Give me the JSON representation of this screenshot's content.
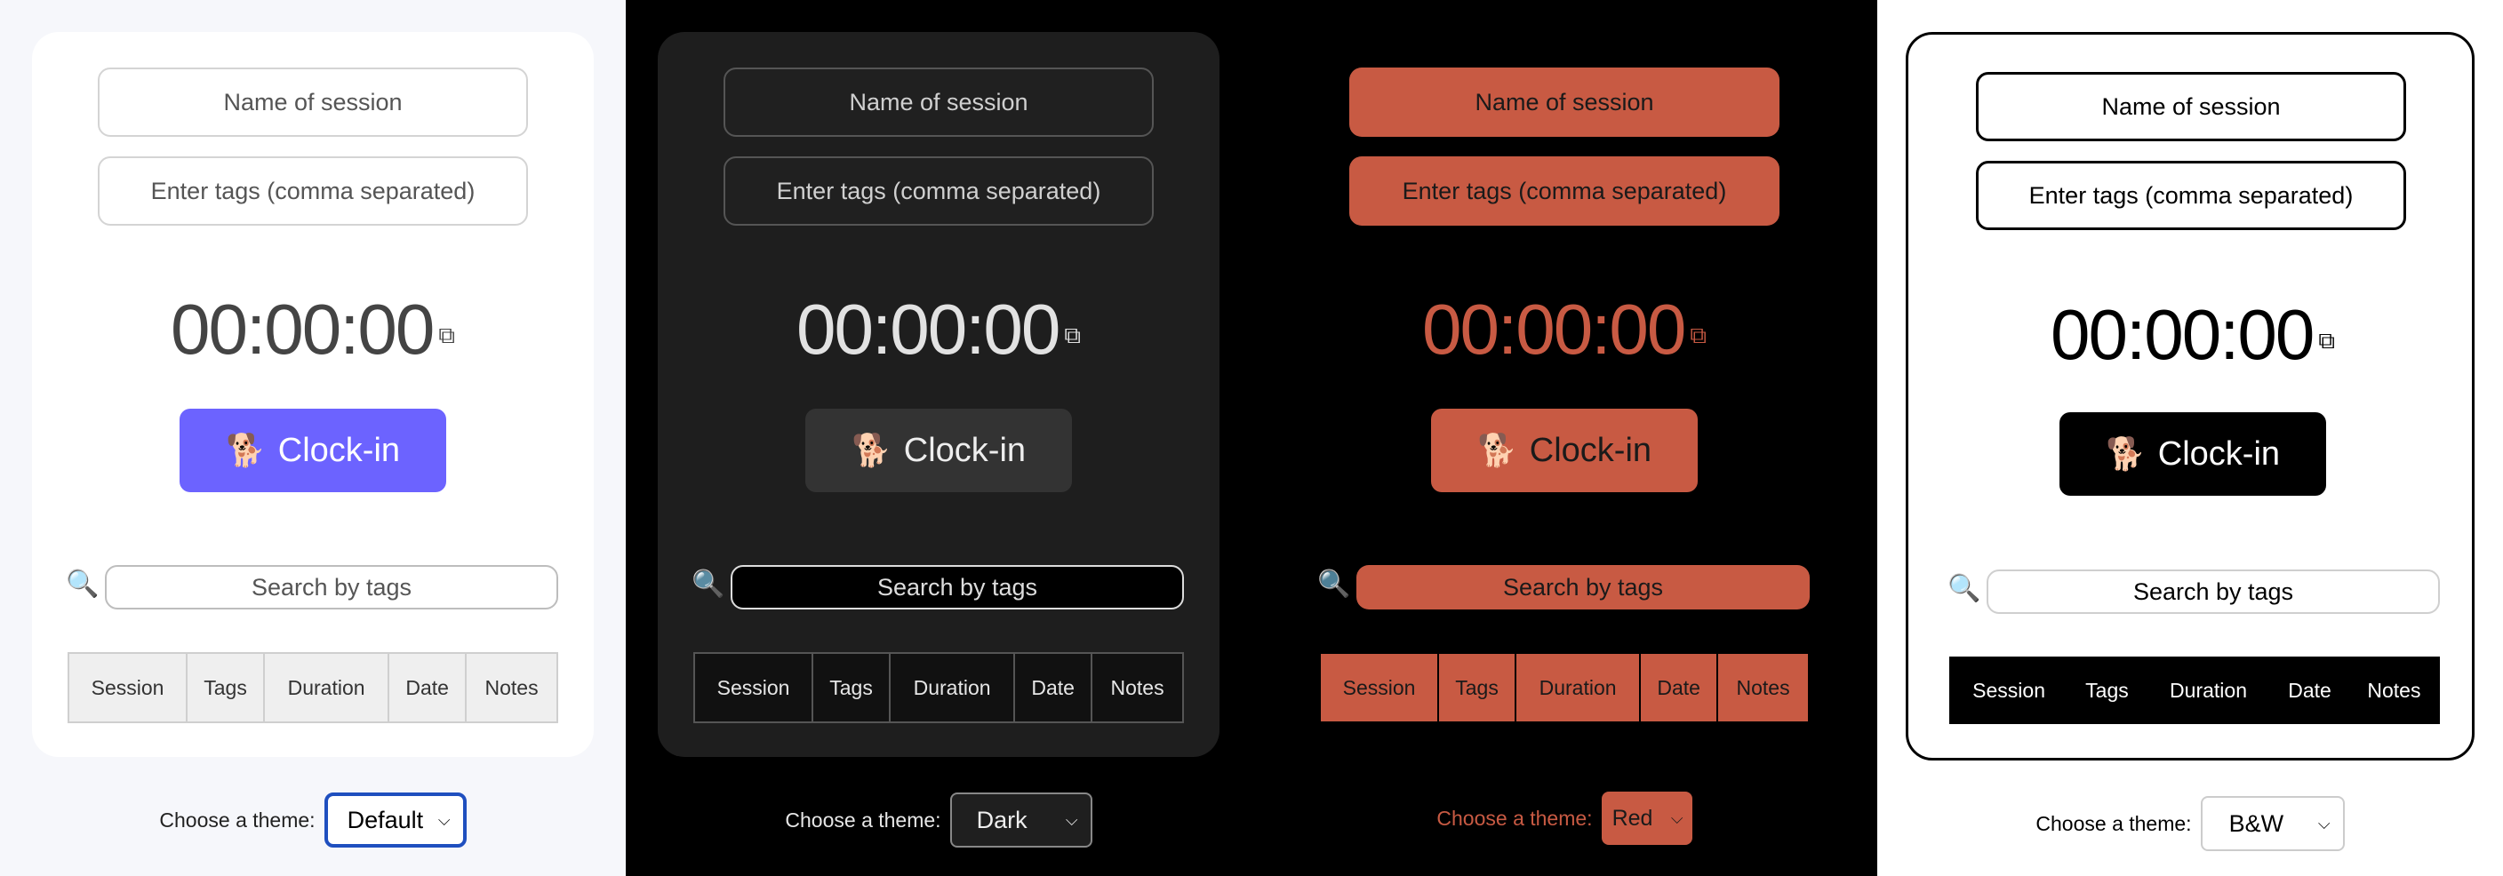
{
  "panels": [
    {
      "theme_key": "default",
      "session_placeholder": "Name of session",
      "tags_placeholder": "Enter tags (comma separated)",
      "timer": "00:00:00",
      "copy_icon": "⧉",
      "clock_in_icon": "walking-dog-icon",
      "clock_in_glyph": "🐕",
      "clock_in_label": "Clock-in",
      "search_icon": "🔍",
      "search_placeholder": "Search by tags",
      "table_headers": [
        "Session",
        "Tags",
        "Duration",
        "Date",
        "Notes"
      ],
      "theme_label": "Choose a theme:",
      "theme_selected": "Default",
      "chevron": "⌵"
    },
    {
      "theme_key": "dark",
      "session_placeholder": "Name of session",
      "tags_placeholder": "Enter tags (comma separated)",
      "timer": "00:00:00",
      "copy_icon": "⧉",
      "clock_in_glyph": "🐕",
      "clock_in_label": "Clock-in",
      "search_icon": "🔍",
      "search_placeholder": "Search by tags",
      "table_headers": [
        "Session",
        "Tags",
        "Duration",
        "Date",
        "Notes"
      ],
      "theme_label": "Choose a theme:",
      "theme_selected": "Dark",
      "chevron": "⌵"
    },
    {
      "theme_key": "red",
      "session_placeholder": "Name of session",
      "tags_placeholder": "Enter tags (comma separated)",
      "timer": "00:00:00",
      "copy_icon": "⧉",
      "clock_in_glyph": "🐕",
      "clock_in_label": "Clock-in",
      "search_icon": "🔍",
      "search_placeholder": "Search by tags",
      "table_headers": [
        "Session",
        "Tags",
        "Duration",
        "Date",
        "Notes"
      ],
      "theme_label": "Choose a theme:",
      "theme_selected": "Red",
      "chevron": "⌵"
    },
    {
      "theme_key": "bw",
      "session_placeholder": "Name of session",
      "tags_placeholder": "Enter tags (comma separated)",
      "timer": "00:00:00",
      "copy_icon": "⧉",
      "clock_in_glyph": "🐕",
      "clock_in_label": "Clock-in",
      "search_icon": "🔍",
      "search_placeholder": "Search by tags",
      "table_headers": [
        "Session",
        "Tags",
        "Duration",
        "Date",
        "Notes"
      ],
      "theme_label": "Choose a theme:",
      "theme_selected": "B&W",
      "chevron": "⌵"
    }
  ],
  "colors": {
    "default_accent": "#6c63ff",
    "dark_bg": "#1e1e1e",
    "red_accent": "#c85a43",
    "bw_accent": "#000000"
  }
}
